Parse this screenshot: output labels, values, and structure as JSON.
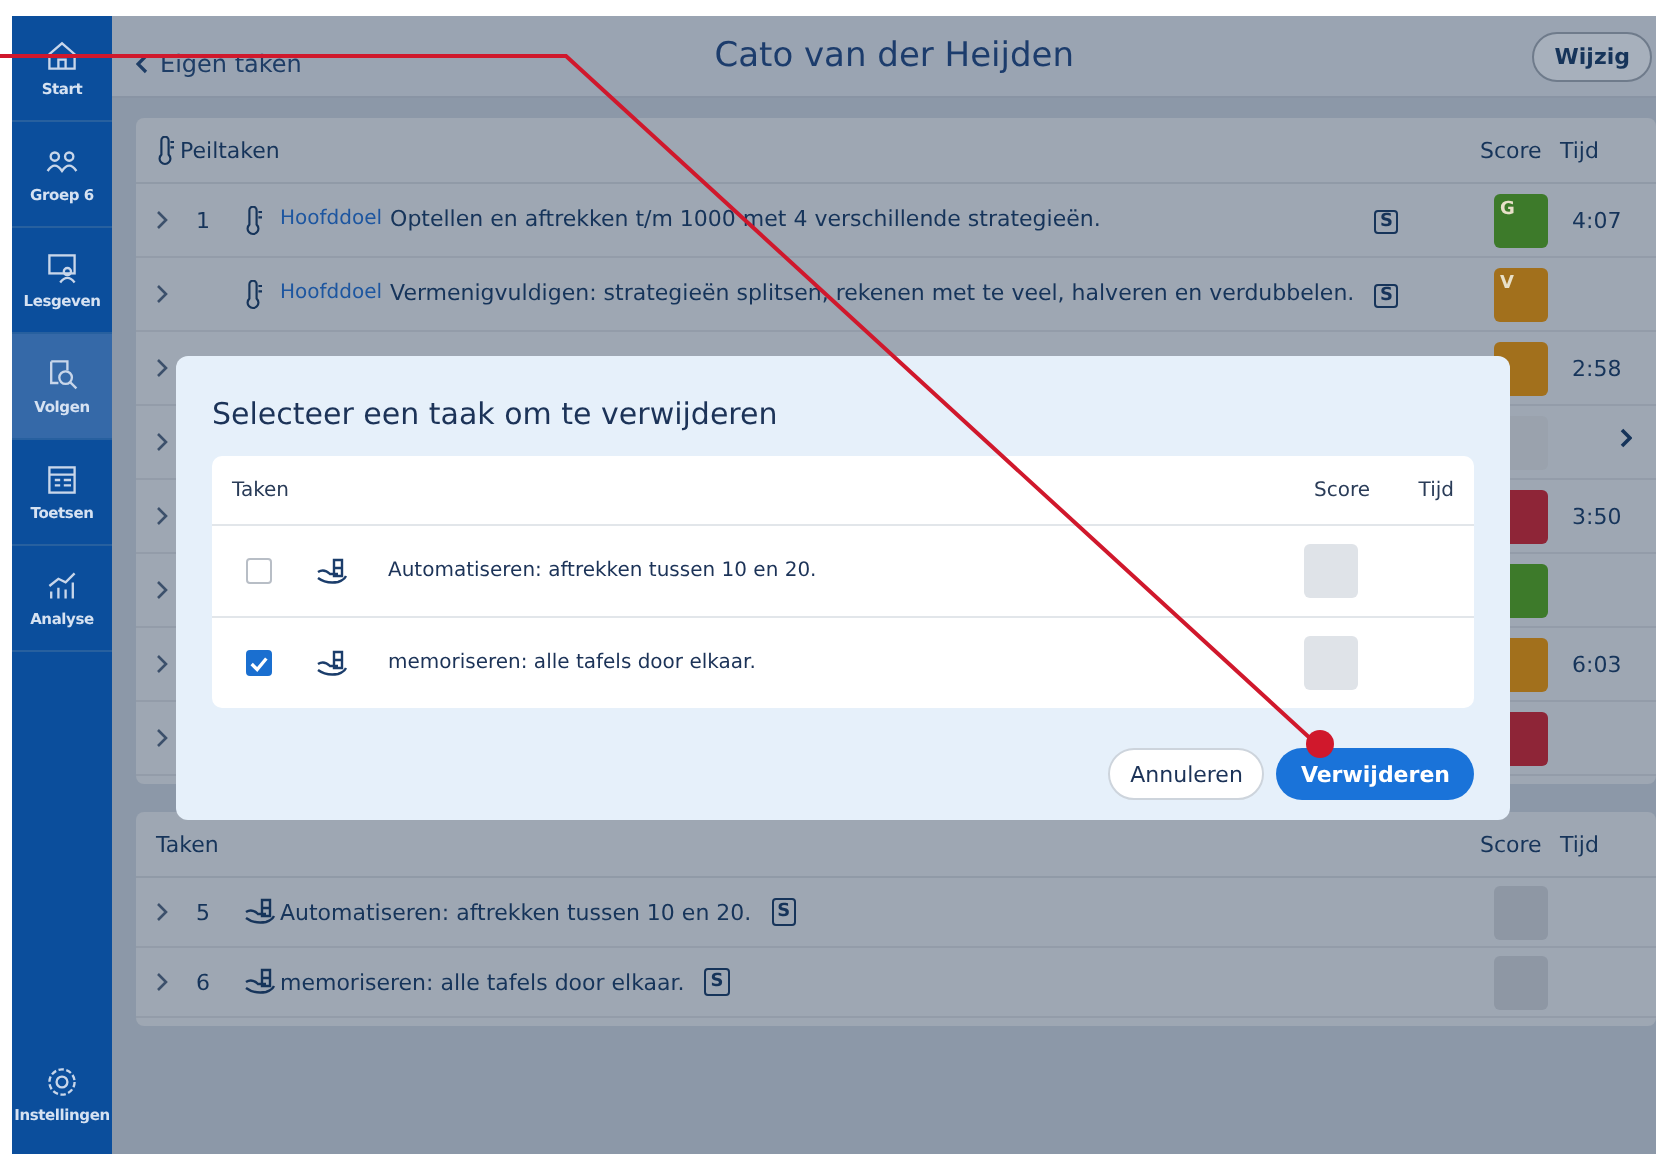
{
  "sidebar": {
    "items": [
      {
        "label": "Start",
        "selected": false
      },
      {
        "label": "Groep 6",
        "selected": false
      },
      {
        "label": "Lesgeven",
        "selected": false
      },
      {
        "label": "Volgen",
        "selected": true
      },
      {
        "label": "Toetsen",
        "selected": false
      },
      {
        "label": "Analyse",
        "selected": false
      }
    ],
    "footer": {
      "label": "Instellingen"
    }
  },
  "header": {
    "back_link": "Eigen taken",
    "title": "Cato van der Heijden",
    "button": "Wijzig"
  },
  "peiltaken": {
    "title": "Peiltaken",
    "score_header": "Score",
    "time_header": "Tijd",
    "rows": [
      {
        "number": "1",
        "tag": "Hoofddoel",
        "text": "Optellen en aftrekken t/m 1000 met 4 verschillende strategieën.",
        "badge": "S",
        "score": "G",
        "color": "#3d7a2a",
        "time": "4:07"
      },
      {
        "tag": "Hoofddoel",
        "text": "Vermenigvuldigen: strategieën splitsen, rekenen met te veel, halveren en verdubbelen.",
        "badge": "S",
        "score": "V",
        "color": "#a2701c"
      },
      {
        "color": "#a2701c",
        "time": "2:58"
      },
      {
        "color": "#9aa2ad"
      },
      {
        "color": "#8e2537",
        "time": "3:50"
      },
      {
        "color": "#3d7a2a"
      },
      {
        "color": "#a2701c",
        "time": "6:03"
      },
      {
        "color": "#8e2537"
      }
    ]
  },
  "taken": {
    "title": "Taken",
    "score_header": "Score",
    "time_header": "Tijd",
    "rows": [
      {
        "number": "5",
        "text": "Automatiseren: aftrekken tussen 10 en 20.",
        "badge": "S"
      },
      {
        "number": "6",
        "text": "memoriseren: alle tafels door elkaar.",
        "badge": "S"
      }
    ]
  },
  "dialog": {
    "title": "Selecteer een taak om te verwijderen",
    "tasks_header": "Taken",
    "score_header": "Score",
    "time_header": "Tijd",
    "rows": [
      {
        "text": "Automatiseren: aftrekken tussen 10 en 20.",
        "checked": false
      },
      {
        "text": "memoriseren: alle tafels door elkaar.",
        "checked": true
      }
    ],
    "cancel": "Annuleren",
    "confirm": "Verwijderen"
  }
}
